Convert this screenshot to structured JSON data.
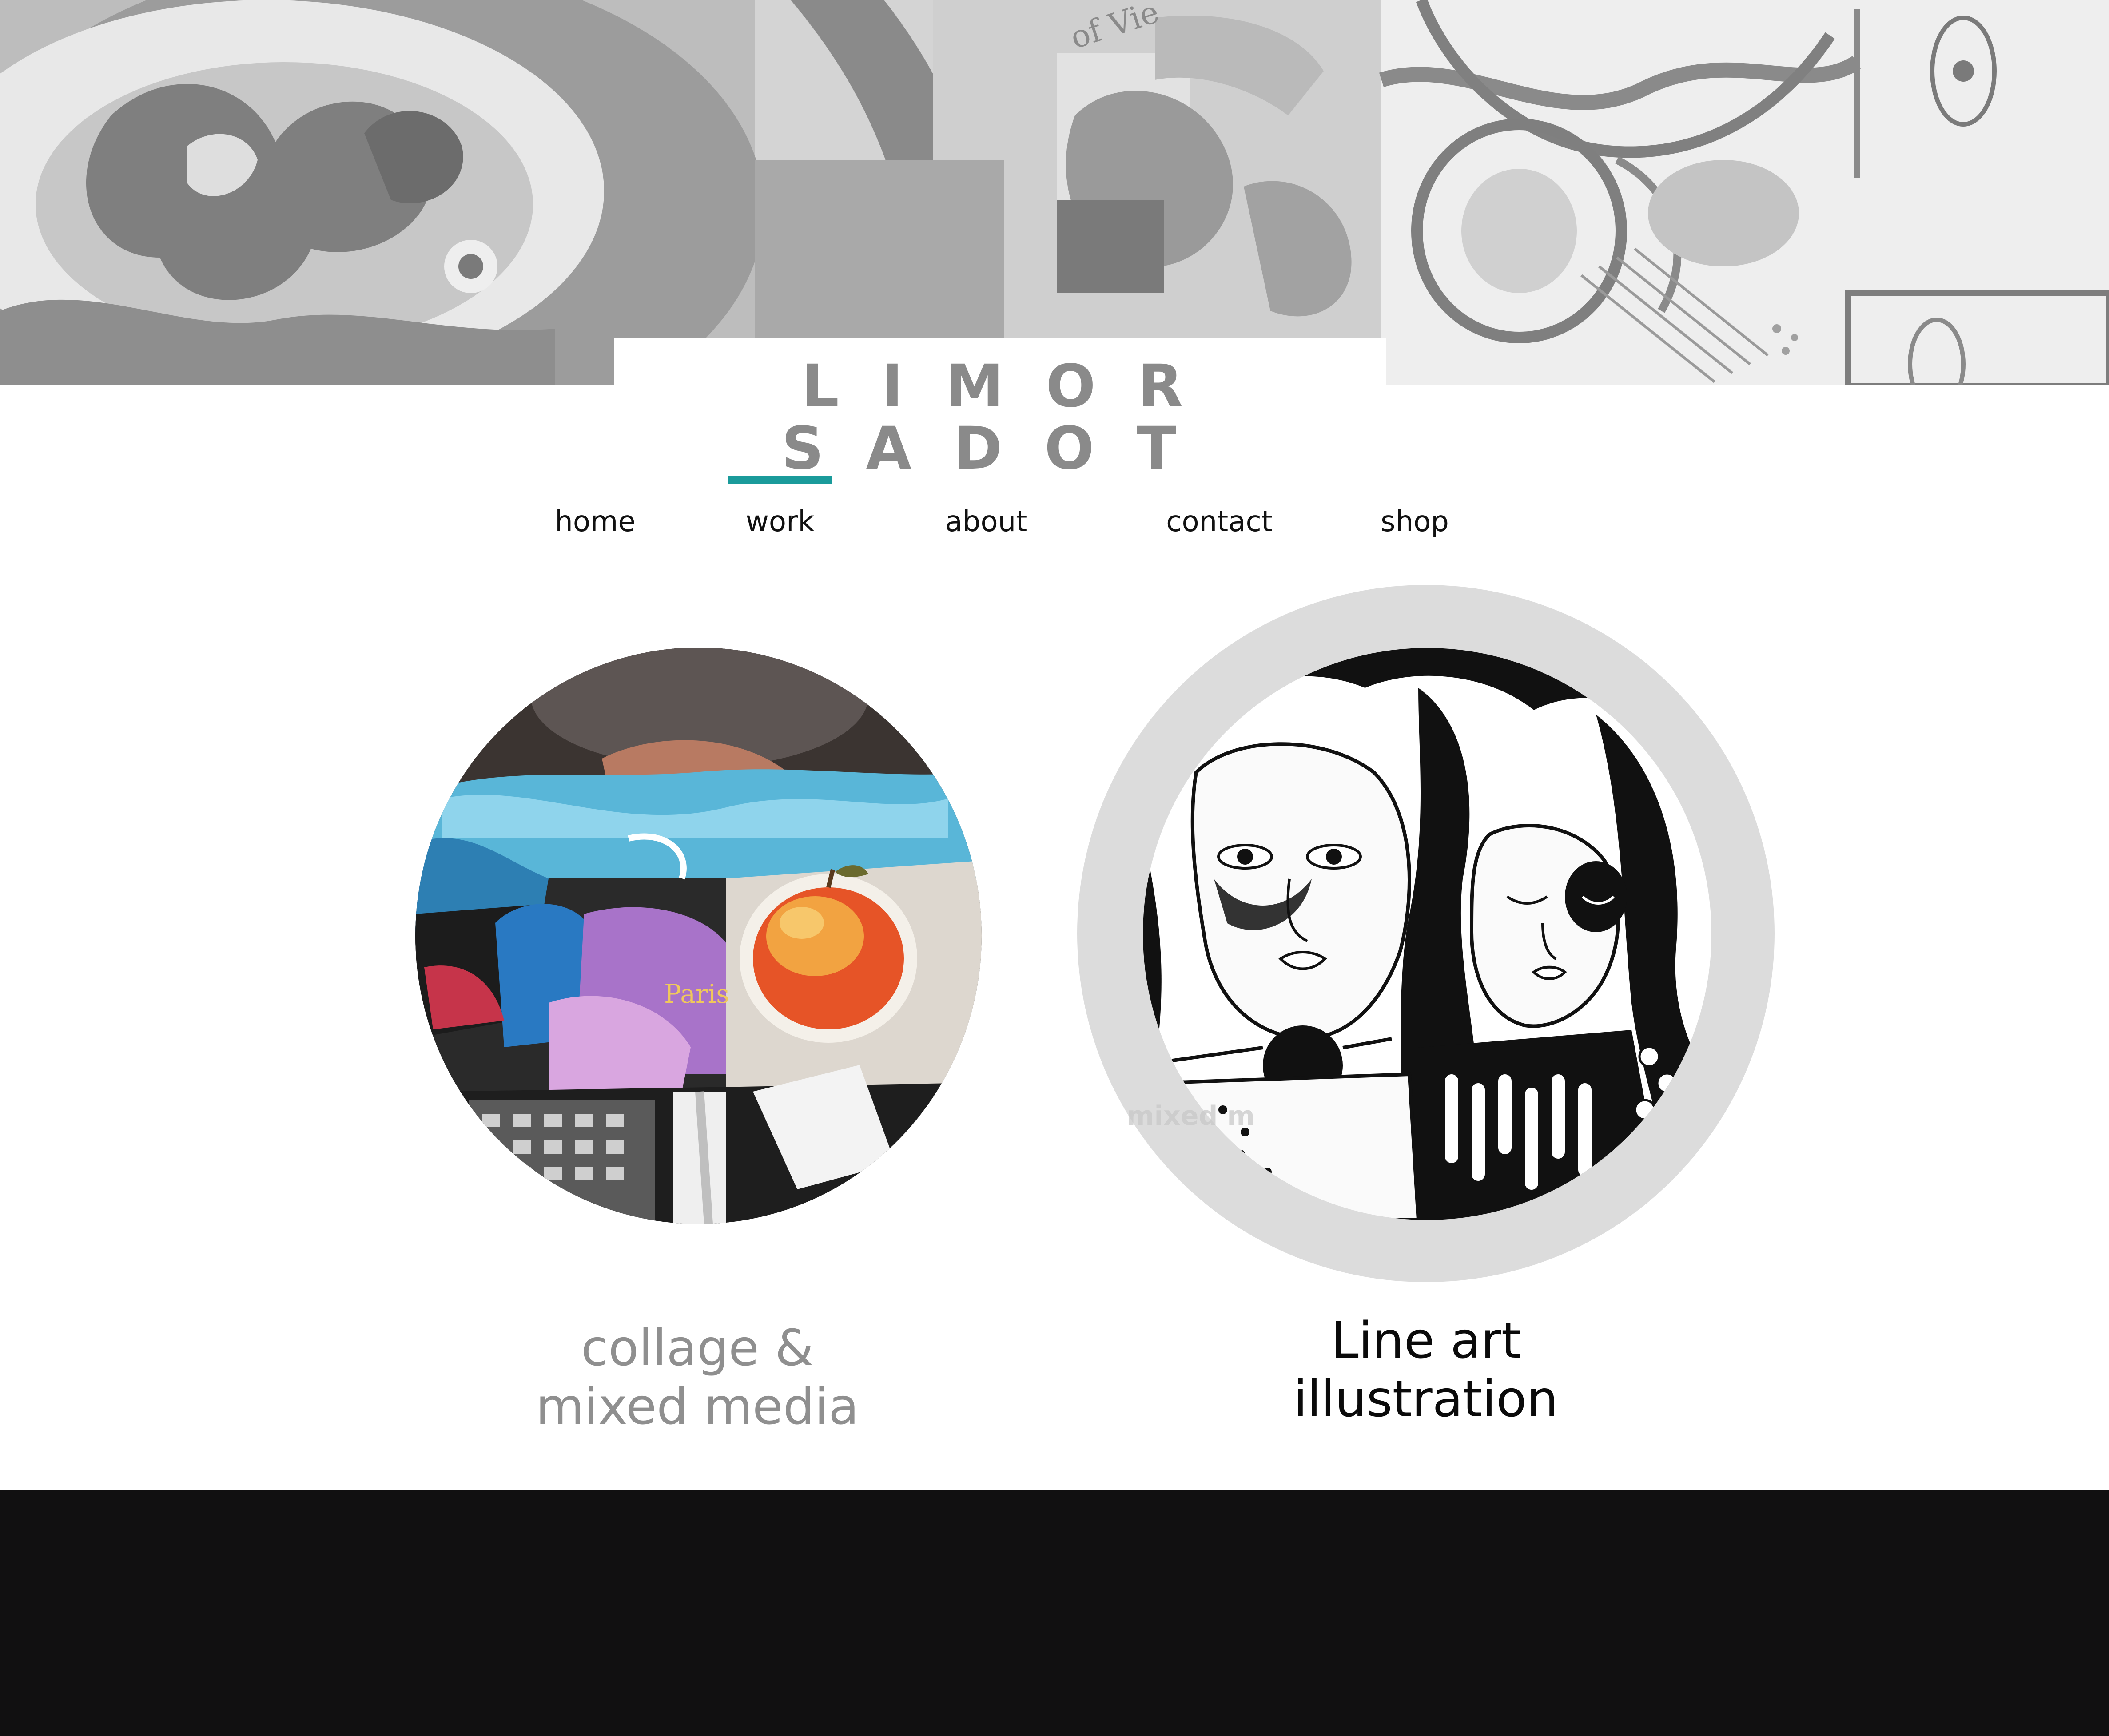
{
  "site": {
    "title": "LIMOR SADOT"
  },
  "colors": {
    "accent": "#1a9b9b",
    "footer": "#111011",
    "muted_text": "#8f8f8f",
    "ring": "#dcdcdc"
  },
  "nav": {
    "items": [
      {
        "label": "home"
      },
      {
        "label": "work",
        "active": true
      },
      {
        "label": "about"
      },
      {
        "label": "contact"
      },
      {
        "label": "shop"
      }
    ]
  },
  "cards": [
    {
      "line1": "collage &",
      "line2": "mixed media",
      "image_icon": "collage-artwork-image",
      "image_text": "Paris",
      "hovered": false
    },
    {
      "line1": "Line art",
      "line2": "illustration",
      "image_icon": "line-art-artwork-image",
      "hovered": true,
      "watermark": "mixed m"
    }
  ]
}
